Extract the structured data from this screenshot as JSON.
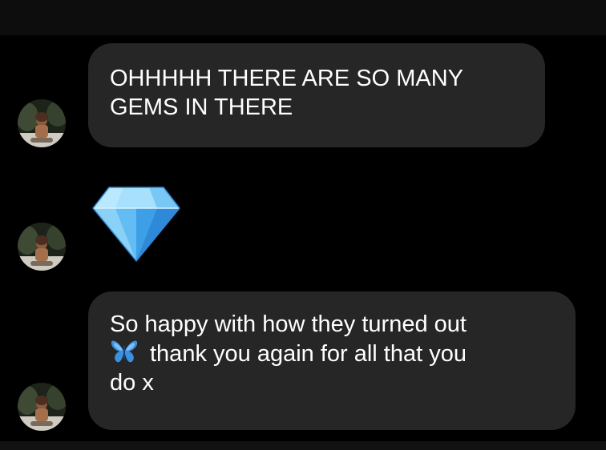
{
  "conversation": {
    "messages": [
      {
        "kind": "text",
        "lines": [
          "OHHHHH THERE ARE SO MANY",
          "GEMS IN THERE"
        ]
      },
      {
        "kind": "emoji",
        "emoji": "gem-stone-icon"
      },
      {
        "kind": "text",
        "lines": [
          "So happy with how they turned out",
          "thank you again for all that you",
          "do x"
        ],
        "inline_emoji": "butterfly-icon"
      }
    ]
  },
  "colors": {
    "background": "#000000",
    "bubble": "#262626",
    "text": "#ffffff",
    "gem": "#6ec3f5",
    "butterfly": "#3d8fe0"
  }
}
